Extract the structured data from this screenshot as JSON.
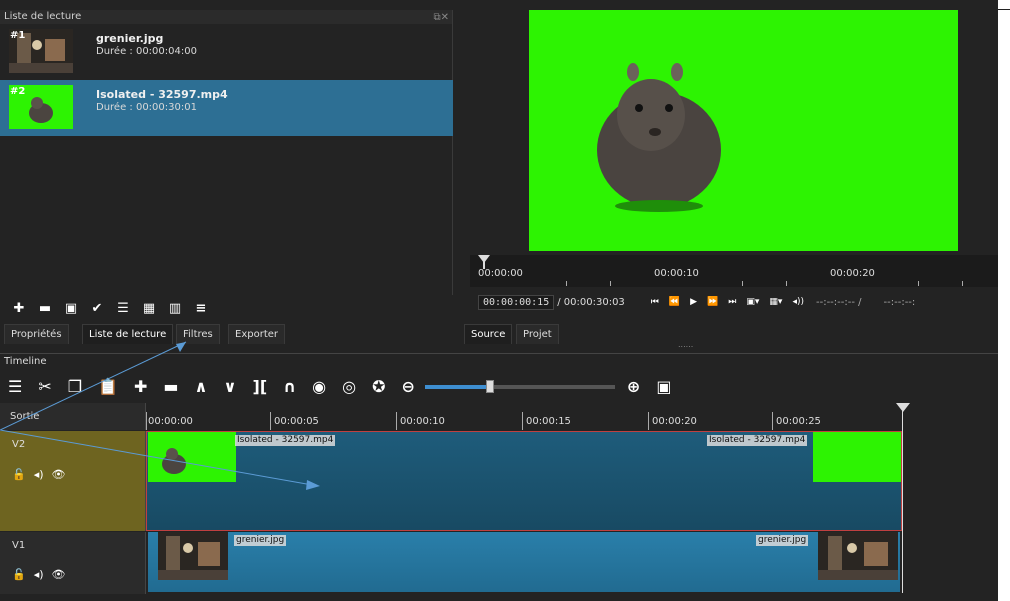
{
  "playlist": {
    "title": "Liste de lecture",
    "items": [
      {
        "num": "#1",
        "name": "grenier.jpg",
        "duration": "Durée : 00:00:04:00"
      },
      {
        "num": "#2",
        "name": "Isolated - 32597.mp4",
        "duration": "Durée : 00:00:30:01"
      }
    ],
    "toolbar_icons": [
      "plus-icon",
      "minus-icon",
      "replace-icon",
      "check-icon",
      "list-view-icon",
      "grid-view-icon",
      "tiles-view-icon",
      "menu-icon"
    ]
  },
  "tabs": {
    "left": [
      "Propriétés",
      "Liste de lecture",
      "Filtres",
      "Exporter"
    ],
    "right": [
      "Source",
      "Projet"
    ]
  },
  "viewer": {
    "ruler_labels": [
      "00:00:00",
      "00:00:10",
      "00:00:20"
    ],
    "current_time": "00:00:00:15",
    "total_time": "/ 00:00:30:03",
    "right_time": "--:--:--:-- /",
    "right_time2": "--:--:--:",
    "dots": "......"
  },
  "timeline": {
    "title": "Timeline",
    "header": "Sortie",
    "ruler_labels": [
      "00:00:00",
      "00:00:05",
      "00:00:10",
      "00:00:15",
      "00:00:20",
      "00:00:25"
    ],
    "tracks": [
      {
        "name": "V2",
        "clip_label_left": "Isolated - 32597.mp4",
        "clip_label_right": "Isolated - 32597.mp4"
      },
      {
        "name": "V1",
        "clip_label_left": "grenier.jpg",
        "clip_label_right": "grenier.jpg"
      }
    ]
  },
  "colors": {
    "green_screen": "#2df302",
    "selection": "#2d6f94",
    "clip_v1": "#2a7faa",
    "clip_v2": "#1e5c7b",
    "track_v2_head": "#6e6420",
    "annotation_arrow": "#5b9bd5"
  }
}
